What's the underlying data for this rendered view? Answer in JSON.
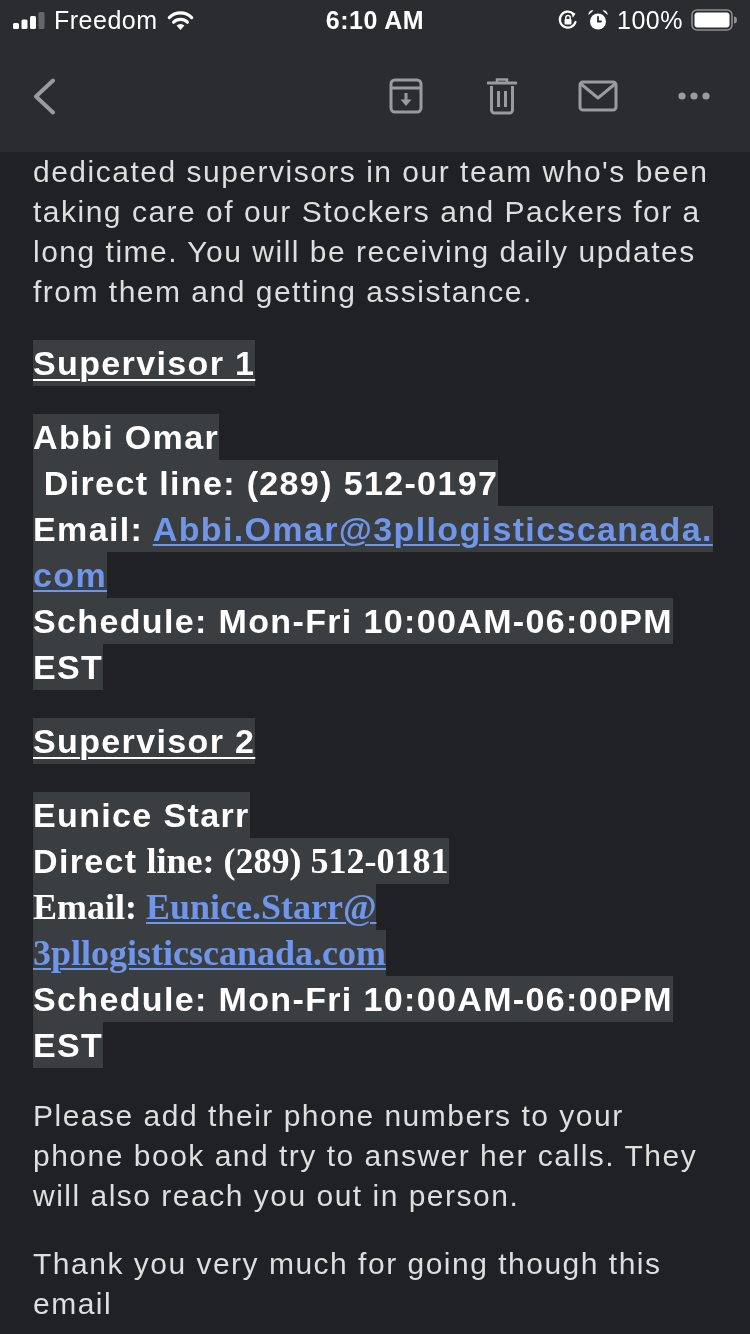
{
  "status_bar": {
    "carrier": "Freedom",
    "time": "6:10 AM",
    "battery": "100%"
  },
  "email_body": [
    {
      "kind": "paragraph",
      "text": "dedicated supervisors in our team who's been taking care of our Stockers and Packers for a long time. You will be receiving daily updates from them and getting assistance."
    },
    {
      "kind": "heading",
      "text": "Supervisor 1"
    },
    {
      "kind": "contact",
      "lines": [
        {
          "kind": "name",
          "segments": [
            {
              "kind": "sans",
              "text": "Abbi Omar"
            }
          ]
        },
        {
          "kind": "phone",
          "segments": [
            {
              "kind": "sans",
              "text": " Direct line: (289) 512-0197"
            }
          ]
        },
        {
          "kind": "email",
          "segments": [
            {
              "kind": "sans",
              "text": "Email: "
            }
          ],
          "link": {
            "kind": "sans",
            "lines": [
              "Abbi.Omar@3pllogisticscanada.",
              "com"
            ]
          }
        },
        {
          "kind": "schedule",
          "segments": [
            {
              "kind": "sans",
              "text": "Schedule: Mon-Fri 10:00AM-06:00PM EST"
            }
          ]
        }
      ]
    },
    {
      "kind": "heading",
      "text": "Supervisor 2"
    },
    {
      "kind": "contact",
      "lines": [
        {
          "kind": "name",
          "segments": [
            {
              "kind": "sans",
              "text": "Eunice Starr"
            }
          ]
        },
        {
          "kind": "phone",
          "segments": [
            {
              "kind": "sans",
              "text": "Direct"
            },
            {
              "kind": "serif",
              "text": " line: (289) 512-0181"
            }
          ]
        },
        {
          "kind": "email",
          "segments": [
            {
              "kind": "serif",
              "text": "Email: "
            }
          ],
          "link": {
            "kind": "serif",
            "lines": [
              "Eunice.Starr@",
              "3pllogisticscanada.com"
            ]
          }
        },
        {
          "kind": "schedule",
          "segments": [
            {
              "kind": "sans",
              "text": "Schedule: Mon-Fri 10:00AM-06:00PM EST"
            }
          ]
        }
      ]
    },
    {
      "kind": "paragraph",
      "text": "Please add their phone numbers to your phone book and try to answer her calls. They will also reach you out in person."
    },
    {
      "kind": "paragraph",
      "text": "Thank you very much for going though this email"
    }
  ]
}
